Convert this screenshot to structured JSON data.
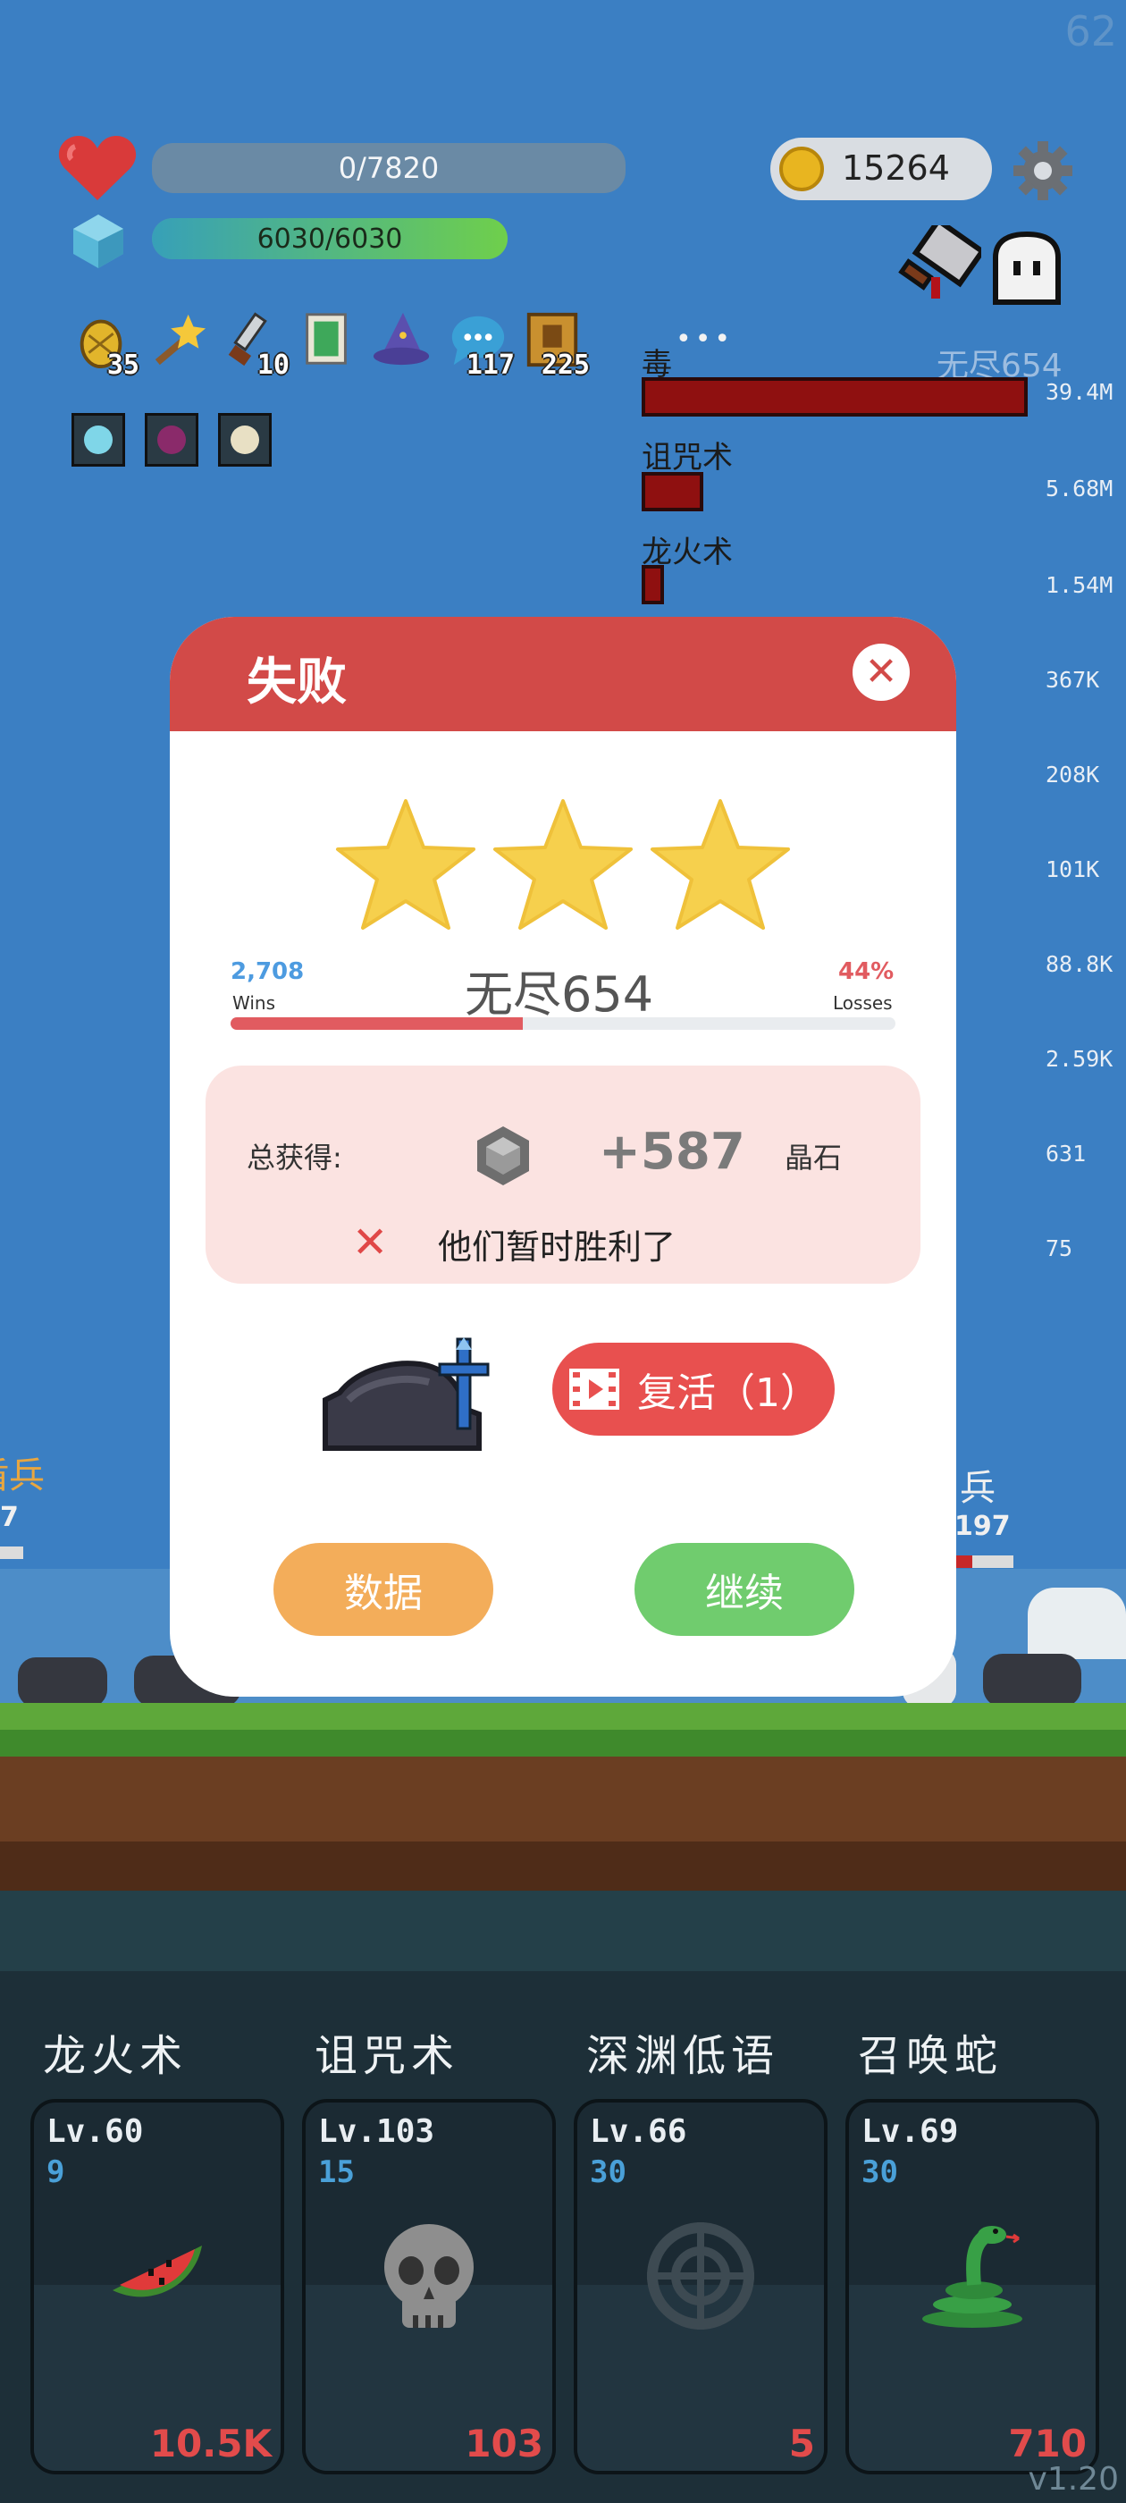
{
  "hud": {
    "fps": "62",
    "health_text": "0/7820",
    "mana_text": "6030/6030",
    "coins": "15264",
    "health_fill": 0,
    "mana_fill": 1.0
  },
  "items": [
    {
      "icon": "pineapple-icon",
      "count": "35"
    },
    {
      "icon": "magic-wand-icon",
      "count": ""
    },
    {
      "icon": "dagger-icon",
      "count": "10"
    },
    {
      "icon": "green-book-icon",
      "count": ""
    },
    {
      "icon": "wizard-hat-icon",
      "count": ""
    },
    {
      "icon": "speech-bubble-icon",
      "count": "117"
    },
    {
      "icon": "spellbook-icon",
      "count": "225"
    }
  ],
  "buffs": [
    {
      "icon": "glowing-buff-icon"
    },
    {
      "icon": "demon-buff-icon"
    },
    {
      "icon": "sun-buff-icon"
    }
  ],
  "stage_label": "无尽654",
  "damage_list": [
    {
      "name": "毒",
      "value": "39.4M",
      "fraction": 1.0
    },
    {
      "name": "诅咒术",
      "value": "5.68M",
      "fraction": 0.144
    },
    {
      "name": "龙火术",
      "value": "1.54M",
      "fraction": 0.039
    },
    {
      "name": "",
      "value": "367K"
    },
    {
      "name": "",
      "value": "208K"
    },
    {
      "name": "",
      "value": "101K"
    },
    {
      "name": "",
      "value": "88.8K"
    },
    {
      "name": "",
      "value": "2.59K"
    },
    {
      "name": "",
      "value": "631"
    },
    {
      "name": "",
      "value": "75"
    }
  ],
  "side_labels": {
    "left_name": "盾兵",
    "left_num": "7",
    "right_name": "兵",
    "right_num": "197"
  },
  "modal": {
    "title": "失败",
    "stars": 3,
    "wins_num": "2,708",
    "wins_label": "Wins",
    "stage": "无尽654",
    "losses_pct": "44%",
    "losses_label": "Losses",
    "progress": 0.44,
    "reward_label": "总获得:",
    "reward_amount": "+587",
    "reward_unit": "晶石",
    "status_text": "他们暂时胜利了",
    "revive_label": "复活（1）",
    "data_button": "数据",
    "continue_button": "继续"
  },
  "skills": [
    {
      "title": "龙火术",
      "level": "Lv.60",
      "cost": "9",
      "value": "10.5K",
      "icon": "watermelon-icon"
    },
    {
      "title": "诅咒术",
      "level": "Lv.103",
      "cost": "15",
      "value": "103",
      "icon": "skull-icon"
    },
    {
      "title": "深渊低语",
      "level": "Lv.66",
      "cost": "30",
      "value": "5",
      "icon": "crosshair-icon"
    },
    {
      "title": "召唤蛇",
      "level": "Lv.69",
      "cost": "30",
      "value": "710",
      "icon": "snake-icon"
    }
  ],
  "version": "v1.20",
  "colors": {
    "sky": "#3b7fc3",
    "modal_header": "#d24a48",
    "revive_button": "#e8504f",
    "data_button": "#f3ad5a",
    "continue_button": "#70cc6e",
    "damage_bar": "#8f1010"
  }
}
